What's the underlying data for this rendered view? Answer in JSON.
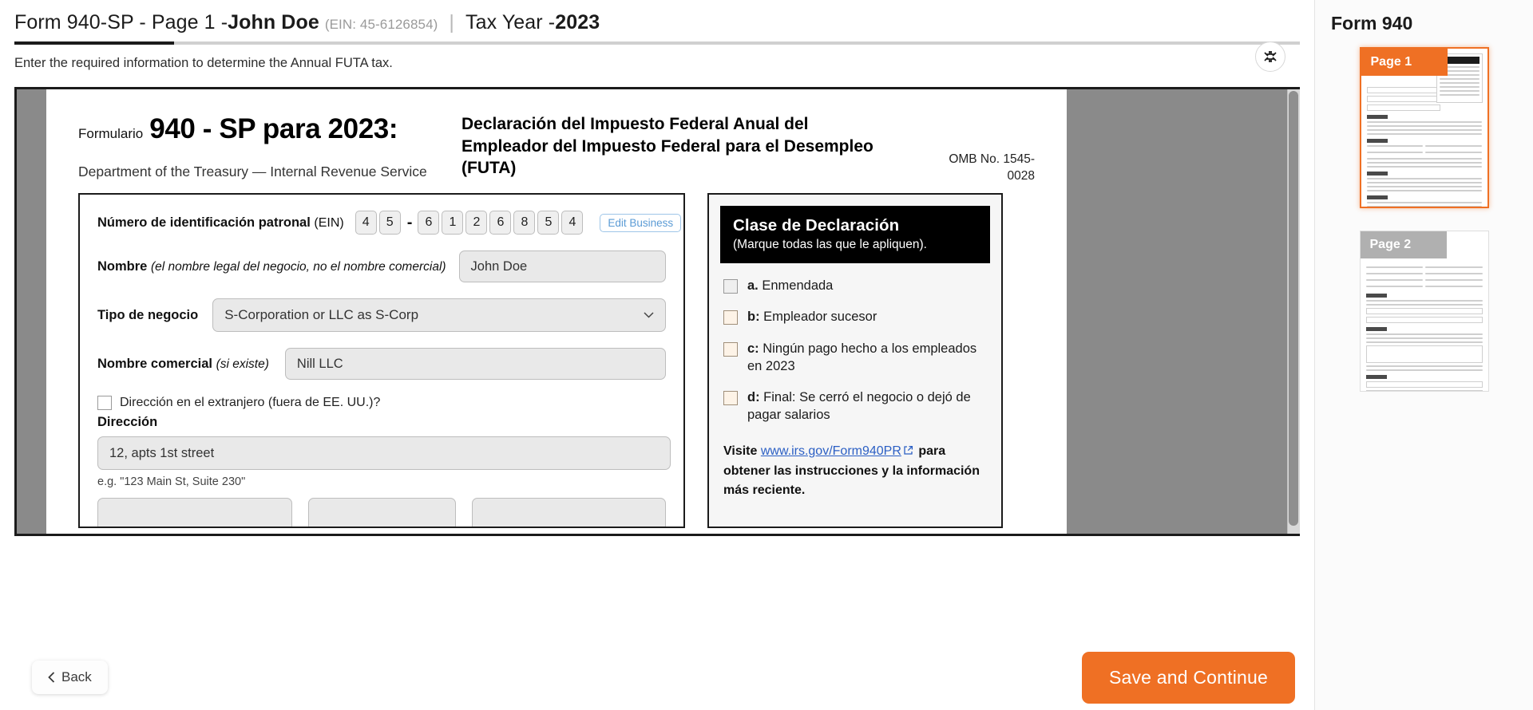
{
  "header": {
    "form_label": "Form 940-SP - Page 1 - ",
    "business_name": "John Doe",
    "ein_note": "(EIN: 45-6126854)",
    "separator": "|",
    "tax_year_label": "Tax Year - ",
    "tax_year": "2023",
    "subtitle": "Enter the required information to determine the Annual FUTA tax.",
    "expand_icon": "collapse-arrows-icon"
  },
  "form": {
    "formulario_label": "Formulario",
    "form_number": "940 - SP para 2023:",
    "department": "Department of the Treasury — Internal Revenue Service",
    "title": "Declaración del Impuesto Federal Anual del Empleador del Impuesto Federal para el Desempleo (FUTA)",
    "omb": "OMB No. 1545-0028",
    "ein": {
      "label": "Número de identificación patronal",
      "label_sub": "(EIN)",
      "digits_prefix": [
        "4",
        "5"
      ],
      "dash": "-",
      "digits_suffix": [
        "6",
        "1",
        "2",
        "6",
        "8",
        "5",
        "4"
      ],
      "edit_button": "Edit Business"
    },
    "nombre": {
      "label": "Nombre",
      "label_italic": "(el nombre legal del negocio, no el nombre comercial)",
      "value": "John Doe",
      "placeholder": "Nombre"
    },
    "tipo_negocio": {
      "label": "Tipo de negocio",
      "value": "S-Corporation or LLC as S-Corp",
      "chevron": "chevron-down-icon"
    },
    "nombre_comercial": {
      "label": "Nombre comercial",
      "label_italic": "(si existe)",
      "value": "Nill LLC",
      "placeholder": "Nombre comercial"
    },
    "foreign_address": {
      "label": "Dirección en el extranjero (fuera de EE. UU.)?",
      "checked": false
    },
    "direccion": {
      "label": "Dirección",
      "value": "12, apts 1st street",
      "hint": "e.g. \"123 Main St, Suite 230\""
    }
  },
  "declaration_panel": {
    "title": "Clase de Declaración",
    "subtitle": "(Marque todas las que le apliquen).",
    "options": [
      {
        "key": "a.",
        "text": "Enmendada",
        "checked": false
      },
      {
        "key": "b:",
        "text": "Empleador sucesor",
        "checked": false
      },
      {
        "key": "c:",
        "text": "Ningún pago hecho a los empleados en 2023",
        "checked": false
      },
      {
        "key": "d:",
        "text": "Final: Se cerró el negocio o dejó de pagar salarios",
        "checked": false
      }
    ],
    "footer_prefix": "Visite ",
    "footer_link": "www.irs.gov/Form940PR",
    "footer_link_icon": "external-link-icon",
    "footer_suffix": " para obtener las instrucciones y la información más reciente."
  },
  "footer": {
    "back_label": "Back",
    "back_icon": "chevron-left-icon",
    "save_label": "Save and Continue"
  },
  "sidebar": {
    "title": "Form 940",
    "pages": [
      {
        "label": "Page 1",
        "active": true
      },
      {
        "label": "Page 2",
        "active": false
      }
    ]
  },
  "colors": {
    "accent_orange": "#ef7024",
    "link_blue": "#2b5fc4",
    "edit_blue": "#5b9bd5",
    "panel_black": "#000000",
    "input_gray": "#e9e9e9"
  }
}
